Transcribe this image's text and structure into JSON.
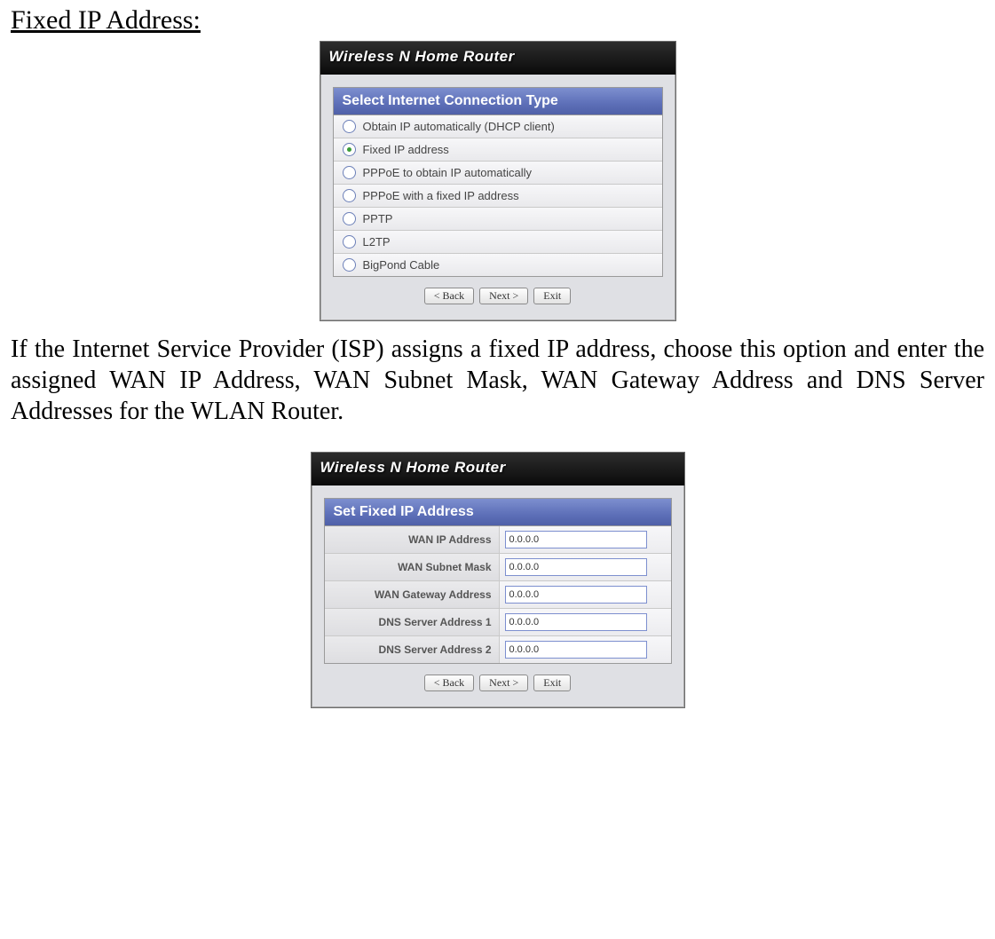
{
  "heading": "Fixed IP Address:",
  "paragraph": "If the Internet Service Provider (ISP) assigns a fixed IP address, choose this option and enter the assigned WAN IP Address, WAN Subnet Mask, WAN Gateway Address and DNS Server Addresses for the WLAN Router.",
  "panel1": {
    "titlebar": "Wireless N Home Router",
    "section_header": "Select Internet Connection Type",
    "options": [
      {
        "label": "Obtain IP automatically (DHCP client)",
        "selected": false
      },
      {
        "label": "Fixed IP address",
        "selected": true
      },
      {
        "label": "PPPoE to obtain IP automatically",
        "selected": false
      },
      {
        "label": "PPPoE with a fixed IP address",
        "selected": false
      },
      {
        "label": "PPTP",
        "selected": false
      },
      {
        "label": "L2TP",
        "selected": false
      },
      {
        "label": "BigPond Cable",
        "selected": false
      }
    ],
    "buttons": {
      "back": "< Back",
      "next": "Next >",
      "exit": "Exit"
    }
  },
  "panel2": {
    "titlebar": "Wireless N Home Router",
    "section_header": "Set Fixed IP Address",
    "fields": [
      {
        "label": "WAN IP Address",
        "value": "0.0.0.0"
      },
      {
        "label": "WAN Subnet Mask",
        "value": "0.0.0.0"
      },
      {
        "label": "WAN Gateway Address",
        "value": "0.0.0.0"
      },
      {
        "label": "DNS Server Address 1",
        "value": "0.0.0.0"
      },
      {
        "label": "DNS Server Address 2",
        "value": "0.0.0.0"
      }
    ],
    "buttons": {
      "back": "< Back",
      "next": "Next >",
      "exit": "Exit"
    }
  }
}
